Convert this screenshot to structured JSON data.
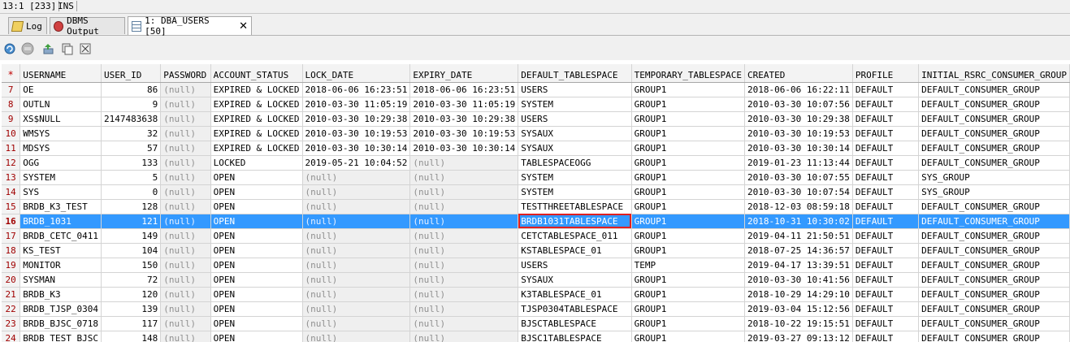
{
  "status": {
    "position": "13:1 [233]",
    "mode": "INS"
  },
  "tabs": [
    {
      "label": "Log",
      "icon": "log-icon"
    },
    {
      "label": "DBMS Output",
      "icon": "dbms-output-icon"
    },
    {
      "label": "1: DBA_USERS [50]",
      "icon": "grid-icon"
    }
  ],
  "toolbar": [
    {
      "name": "refresh-icon"
    },
    {
      "name": "stop-icon"
    },
    {
      "name": "export-icon"
    },
    {
      "name": "copy-icon"
    },
    {
      "name": "filter-icon"
    }
  ],
  "grid": {
    "header_marker": "*",
    "columns": [
      "USERNAME",
      "USER_ID",
      "PASSWORD",
      "ACCOUNT_STATUS",
      "LOCK_DATE",
      "EXPIRY_DATE",
      "DEFAULT_TABLESPACE",
      "TEMPORARY_TABLESPACE",
      "CREATED",
      "PROFILE",
      "INITIAL_RSRC_CONSUMER_GROUP"
    ],
    "selected_row": 16,
    "rows": [
      [
        "7",
        "OE",
        "86",
        "(null)",
        "EXPIRED & LOCKED",
        "2018-06-06 16:23:51",
        "2018-06-06 16:23:51",
        "USERS",
        "GROUP1",
        "2018-06-06 16:22:11",
        "DEFAULT",
        "DEFAULT_CONSUMER_GROUP"
      ],
      [
        "8",
        "OUTLN",
        "9",
        "(null)",
        "EXPIRED & LOCKED",
        "2010-03-30 11:05:19",
        "2010-03-30 11:05:19",
        "SYSTEM",
        "GROUP1",
        "2010-03-30 10:07:56",
        "DEFAULT",
        "DEFAULT_CONSUMER_GROUP"
      ],
      [
        "9",
        "XS$NULL",
        "2147483638",
        "(null)",
        "EXPIRED & LOCKED",
        "2010-03-30 10:29:38",
        "2010-03-30 10:29:38",
        "USERS",
        "GROUP1",
        "2010-03-30 10:29:38",
        "DEFAULT",
        "DEFAULT_CONSUMER_GROUP"
      ],
      [
        "10",
        "WMSYS",
        "32",
        "(null)",
        "EXPIRED & LOCKED",
        "2010-03-30 10:19:53",
        "2010-03-30 10:19:53",
        "SYSAUX",
        "GROUP1",
        "2010-03-30 10:19:53",
        "DEFAULT",
        "DEFAULT_CONSUMER_GROUP"
      ],
      [
        "11",
        "MDSYS",
        "57",
        "(null)",
        "EXPIRED & LOCKED",
        "2010-03-30 10:30:14",
        "2010-03-30 10:30:14",
        "SYSAUX",
        "GROUP1",
        "2010-03-30 10:30:14",
        "DEFAULT",
        "DEFAULT_CONSUMER_GROUP"
      ],
      [
        "12",
        "OGG",
        "133",
        "(null)",
        "LOCKED",
        "2019-05-21 10:04:52",
        "(null)",
        "TABLESPACEOGG",
        "GROUP1",
        "2019-01-23 11:13:44",
        "DEFAULT",
        "DEFAULT_CONSUMER_GROUP"
      ],
      [
        "13",
        "SYSTEM",
        "5",
        "(null)",
        "OPEN",
        "(null)",
        "(null)",
        "SYSTEM",
        "GROUP1",
        "2010-03-30 10:07:55",
        "DEFAULT",
        "SYS_GROUP"
      ],
      [
        "14",
        "SYS",
        "0",
        "(null)",
        "OPEN",
        "(null)",
        "(null)",
        "SYSTEM",
        "GROUP1",
        "2010-03-30 10:07:54",
        "DEFAULT",
        "SYS_GROUP"
      ],
      [
        "15",
        "BRDB_K3_TEST",
        "128",
        "(null)",
        "OPEN",
        "(null)",
        "(null)",
        "TESTTHREETABLESPACE",
        "GROUP1",
        "2018-12-03 08:59:18",
        "DEFAULT",
        "DEFAULT_CONSUMER_GROUP"
      ],
      [
        "16",
        "BRDB_1031",
        "121",
        "(null)",
        "OPEN",
        "(null)",
        "(null)",
        "BRDB1031TABLESPACE",
        "GROUP1",
        "2018-10-31 10:30:02",
        "DEFAULT",
        "DEFAULT_CONSUMER_GROUP"
      ],
      [
        "17",
        "BRDB_CETC_0411",
        "149",
        "(null)",
        "OPEN",
        "(null)",
        "(null)",
        "CETCTABLESPACE_011",
        "GROUP1",
        "2019-04-11 21:50:51",
        "DEFAULT",
        "DEFAULT_CONSUMER_GROUP"
      ],
      [
        "18",
        "KS_TEST",
        "104",
        "(null)",
        "OPEN",
        "(null)",
        "(null)",
        "KSTABLESPACE_01",
        "GROUP1",
        "2018-07-25 14:36:57",
        "DEFAULT",
        "DEFAULT_CONSUMER_GROUP"
      ],
      [
        "19",
        "MONITOR",
        "150",
        "(null)",
        "OPEN",
        "(null)",
        "(null)",
        "USERS",
        "TEMP",
        "2019-04-17 13:39:51",
        "DEFAULT",
        "DEFAULT_CONSUMER_GROUP"
      ],
      [
        "20",
        "SYSMAN",
        "72",
        "(null)",
        "OPEN",
        "(null)",
        "(null)",
        "SYSAUX",
        "GROUP1",
        "2010-03-30 10:41:56",
        "DEFAULT",
        "DEFAULT_CONSUMER_GROUP"
      ],
      [
        "21",
        "BRDB_K3",
        "120",
        "(null)",
        "OPEN",
        "(null)",
        "(null)",
        "K3TABLESPACE_01",
        "GROUP1",
        "2018-10-29 14:29:10",
        "DEFAULT",
        "DEFAULT_CONSUMER_GROUP"
      ],
      [
        "22",
        "BRDB_TJSP_0304",
        "139",
        "(null)",
        "OPEN",
        "(null)",
        "(null)",
        "TJSP0304TABLESPACE",
        "GROUP1",
        "2019-03-04 15:12:56",
        "DEFAULT",
        "DEFAULT_CONSUMER_GROUP"
      ],
      [
        "23",
        "BRDB_BJSC_0718",
        "117",
        "(null)",
        "OPEN",
        "(null)",
        "(null)",
        "BJSCTABLESPACE",
        "GROUP1",
        "2018-10-22 19:15:51",
        "DEFAULT",
        "DEFAULT_CONSUMER_GROUP"
      ],
      [
        "24",
        "BRDB_TEST_BJSC",
        "148",
        "(null)",
        "OPEN",
        "(null)",
        "(null)",
        "BJSC1TABLESPACE",
        "GROUP1",
        "2019-03-27 09:13:12",
        "DEFAULT",
        "DEFAULT_CONSUMER_GROUP"
      ]
    ]
  }
}
